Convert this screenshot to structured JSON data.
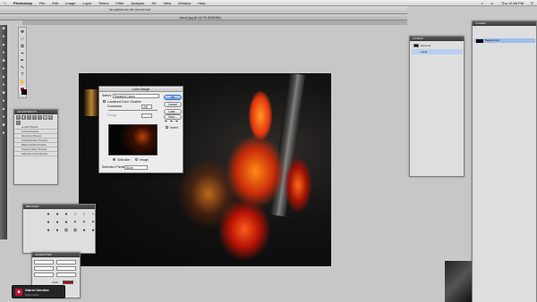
{
  "menubar": {
    "app": "Photoshop",
    "items": [
      "File",
      "Edit",
      "Image",
      "Layer",
      "Select",
      "Filter",
      "Analysis",
      "3D",
      "View",
      "Window",
      "Help"
    ],
    "time": "Thu 12:56 PM"
  },
  "options": {
    "notice": "No options for the current tool"
  },
  "document": {
    "title": "sixes2.jpg @ 16.7% (RGB/8#)"
  },
  "color_range_dialog": {
    "title": "Color Range",
    "select_label": "Select:",
    "select_value": "Sampled Colors",
    "localized_label": "Localized Color Clusters",
    "fuzziness_label": "Fuzziness:",
    "fuzziness_value": "200",
    "range_label": "Range:",
    "buttons": {
      "ok": "OK",
      "cancel": "Cancel",
      "load": "Load...",
      "save": "Save..."
    },
    "invert_label": "Invert",
    "radio_selection": "Selection",
    "radio_image": "Image",
    "selection_preview_label": "Selection Preview:",
    "selection_preview_value": "None"
  },
  "adjustments_panel": {
    "title": "ADJUSTMENTS",
    "presets": [
      "Levels Presets",
      "Curves Presets",
      "Exposure Presets",
      "Hue/Saturation Presets",
      "Black & White Presets",
      "Channel Mixer Presets",
      "Selective Color Presets"
    ]
  },
  "brush_panel": {
    "title": "BRUSHES"
  },
  "character_panel": {
    "title": "CHARACTER",
    "color_label": "Color:"
  },
  "layers_panel": {
    "title": "LAYERS",
    "rows": [
      "Hammer",
      "Layer"
    ]
  },
  "right_panel": {
    "title": "LAYERS",
    "layer_name": "Background"
  },
  "notification": {
    "title": "Gabriel Valentine",
    "subtitle": "Open client"
  },
  "colors": {
    "foreground": "#c0001a",
    "background": "#000000",
    "accent": "#3f7fe0"
  }
}
